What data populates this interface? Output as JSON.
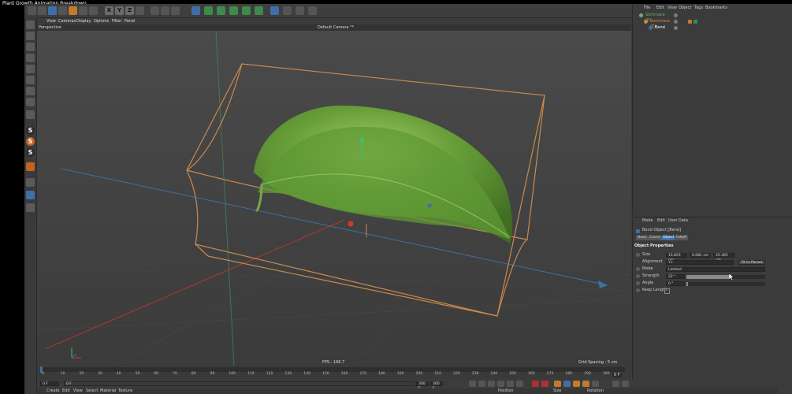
{
  "window": {
    "title": "Plant Growth Animation Breakdown"
  },
  "toolbar": {
    "x": "X",
    "y": "Y",
    "z": "Z"
  },
  "left_toolbar": {
    "s1": "S",
    "s2": "S",
    "s3": "S"
  },
  "viewport": {
    "menu": [
      "View",
      "Cameras",
      "Display",
      "Options",
      "Filter",
      "Panel"
    ],
    "view_name": "Perspective",
    "camera_name": "Default Camera °*",
    "fps": "FPS : 166.7",
    "grid_spacing": "Grid Spacing : 5 cm"
  },
  "timeline": {
    "ticks": [
      "0",
      "10",
      "20",
      "30",
      "40",
      "50",
      "60",
      "70",
      "80",
      "90",
      "100",
      "110",
      "120",
      "130",
      "140",
      "150",
      "160",
      "170",
      "180",
      "190",
      "200",
      "210",
      "220",
      "230",
      "240",
      "250",
      "260",
      "270",
      "280",
      "290",
      "300"
    ],
    "current_frame": "0 F",
    "start_field": "0 F",
    "min_field": "0 F",
    "end_field": "300 F",
    "max_field": "300 F"
  },
  "bottom_menu": [
    "Create",
    "Edit",
    "View",
    "Select",
    "Material",
    "Texture"
  ],
  "coord_headers": {
    "position": "Position",
    "size": "Size",
    "rotation": "Rotation"
  },
  "object_manager": {
    "menu": [
      "File",
      "Edit",
      "View",
      "Object",
      "Tags",
      "Bookmarks"
    ],
    "items": [
      {
        "name": "Sommace (E)",
        "color": "#6fb06f"
      },
      {
        "name": "Sommace (E)",
        "color": "#d28a3c"
      },
      {
        "name": "Bend",
        "color": "#d9d9d9"
      }
    ]
  },
  "attributes": {
    "menu": [
      "Mode",
      "Edit",
      "User Data"
    ],
    "object_title": "Bend Object [Bend]",
    "tabs": [
      "Basic",
      "Coord.",
      "Object",
      "Falloff"
    ],
    "active_tab": "Object",
    "section_title": "Object Properties",
    "size_label": "Size",
    "size_x": "15.855 cm",
    "size_y": "6.081 cm",
    "size_z": "25.365 cm",
    "alignment_label": "Alignment",
    "alignment_value": "Y+",
    "fit_button": "Fit to Parent",
    "mode_label": "Mode",
    "mode_value": "Limited",
    "strength_label": "Strength",
    "strength_value": "22 °",
    "strength_fraction": 0.55,
    "angle_label": "Angle",
    "angle_value": "0 °",
    "keep_length_label": "Keep Length"
  },
  "colors": {
    "accent_blue": "#3f6fa8",
    "bbox_orange": "#c98a4e",
    "leaf_green": "#6aa03a",
    "viewport_bg": "#4a4a4a"
  }
}
